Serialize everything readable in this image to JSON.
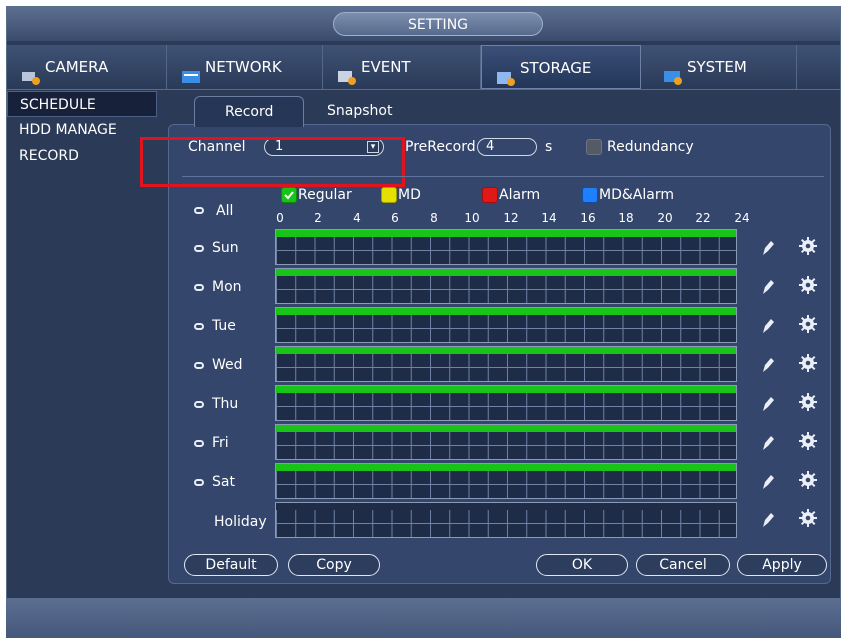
{
  "title": "SETTING",
  "tabs": [
    {
      "label": "CAMERA",
      "icon": "camera-icon"
    },
    {
      "label": "NETWORK",
      "icon": "network-icon"
    },
    {
      "label": "EVENT",
      "icon": "event-icon"
    },
    {
      "label": "STORAGE",
      "icon": "storage-icon",
      "active": true
    },
    {
      "label": "SYSTEM",
      "icon": "system-icon"
    }
  ],
  "leftnav": [
    {
      "label": "SCHEDULE",
      "active": true
    },
    {
      "label": "HDD MANAGE"
    },
    {
      "label": "RECORD"
    }
  ],
  "subtabs": {
    "record": "Record",
    "snapshot": "Snapshot"
  },
  "channel": {
    "label": "Channel",
    "value": "1"
  },
  "prerecord": {
    "label": "PreRecord",
    "value": "4",
    "unit": "s"
  },
  "redundancy": {
    "label": "Redundancy",
    "checked": false
  },
  "legend": {
    "regular": "Regular",
    "md": "MD",
    "alarm": "Alarm",
    "md_alarm": "MD&Alarm"
  },
  "all_label": "All",
  "hours": [
    "0",
    "2",
    "4",
    "6",
    "8",
    "10",
    "12",
    "14",
    "16",
    "18",
    "20",
    "22",
    "24"
  ],
  "days": [
    "Sun",
    "Mon",
    "Tue",
    "Wed",
    "Thu",
    "Fri",
    "Sat",
    "Holiday"
  ],
  "buttons": {
    "default": "Default",
    "copy": "Copy",
    "ok": "OK",
    "cancel": "Cancel",
    "apply": "Apply"
  },
  "colors": {
    "regular": "#19c419",
    "md": "#e6e000",
    "alarm": "#e01818",
    "md_alarm": "#1e7fff",
    "highlight": "#e0141e"
  }
}
